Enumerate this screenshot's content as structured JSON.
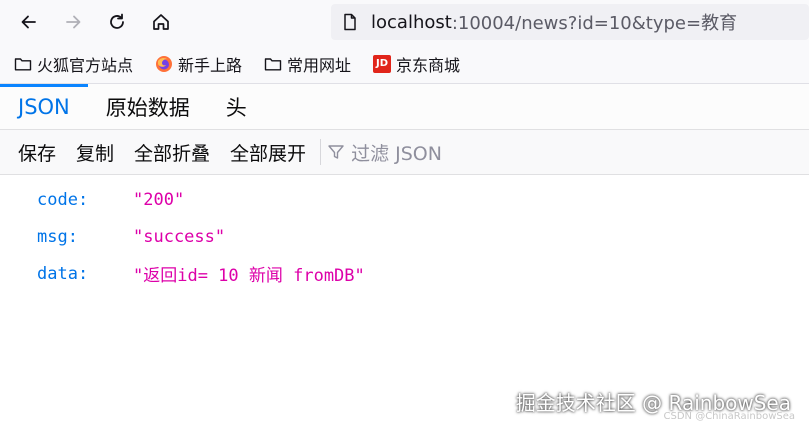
{
  "browser": {
    "nav_icons": [
      "back-arrow-icon",
      "forward-arrow-icon",
      "reload-icon",
      "home-icon"
    ],
    "url_host": "localhost",
    "url_rest": ":10004/news?id=10&type=教育"
  },
  "bookmarks": [
    {
      "label": "火狐官方站点",
      "icon": "folder-icon"
    },
    {
      "label": "新手上路",
      "icon": "firefox-icon"
    },
    {
      "label": "常用网址",
      "icon": "folder-icon"
    },
    {
      "label": "京东商城",
      "icon": "jd-logo-icon",
      "logo_text": "JD"
    }
  ],
  "viewer": {
    "tabs": [
      {
        "label": "JSON",
        "active": true
      },
      {
        "label": "原始数据",
        "active": false
      },
      {
        "label": "头",
        "active": false
      }
    ],
    "actions": [
      "保存",
      "复制",
      "全部折叠",
      "全部展开"
    ],
    "filter_placeholder": "过滤 JSON"
  },
  "json_rows": [
    {
      "key": "code:",
      "value": "\"200\""
    },
    {
      "key": "msg:",
      "value": "\"success\""
    },
    {
      "key": "data:",
      "value": "\"返回id= 10 新闻 fromDB\""
    }
  ],
  "colors": {
    "key": "#0074e8",
    "string": "#dd00a9",
    "tab_active": "#0074e8"
  },
  "watermark": {
    "main": "掘金技术社区 @ RainbowSea",
    "sub": "CSDN @ChinaRainbowSea"
  }
}
